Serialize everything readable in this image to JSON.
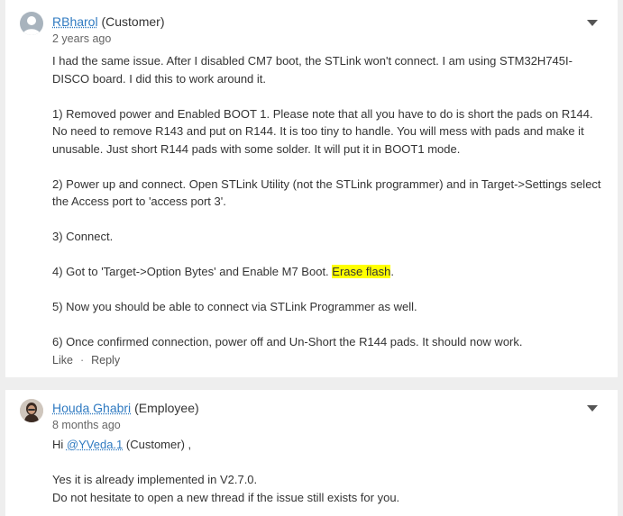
{
  "post1": {
    "author": "RBharol",
    "role": "(Customer)",
    "time": "2 years ago",
    "paragraphs": [
      "I had the same issue. After I disabled CM7 boot, the STLink won't connect. I am using STM32H745I-DISCO board. I did this to work around it.",
      "1) Removed power and Enabled BOOT 1. Please note that all you have to do is short the pads on R144. No need to remove R143 and put on R144. It is too tiny to handle. You will mess with pads and make it unusable. Just short R144 pads with some solder. It will put it in BOOT1 mode.",
      "2) Power up and connect. Open STLink Utility (not the STLink programmer) and in Target->Settings select the Access port to 'access port 3'.",
      "3) Connect.",
      "4) Got to 'Target->Option Bytes' and Enable M7 Boot.",
      "5) Now you should be able to connect via STLink Programmer as well.",
      "6) Once confirmed connection, power off and Un-Short the R144 pads. It should now work."
    ],
    "highlight": "Erase flash",
    "highlight_tail": ".",
    "like_label": "Like",
    "separator": "·",
    "reply_label": "Reply"
  },
  "post2": {
    "author": "Houda Ghabri",
    "role": "(Employee)",
    "time": "8 months ago",
    "greeting": "Hi",
    "mention": "@YVeda.1",
    "mention_role": "(Customer)",
    "greeting_tail": ",",
    "lines": [
      "Yes it is already implemented in V2.7.0.",
      "Do not hesitate to open a new thread if the issue still exists for you."
    ]
  },
  "colors": {
    "link": "#2f7ac1",
    "highlight": "#ffff00",
    "background": "#eeeeee"
  }
}
